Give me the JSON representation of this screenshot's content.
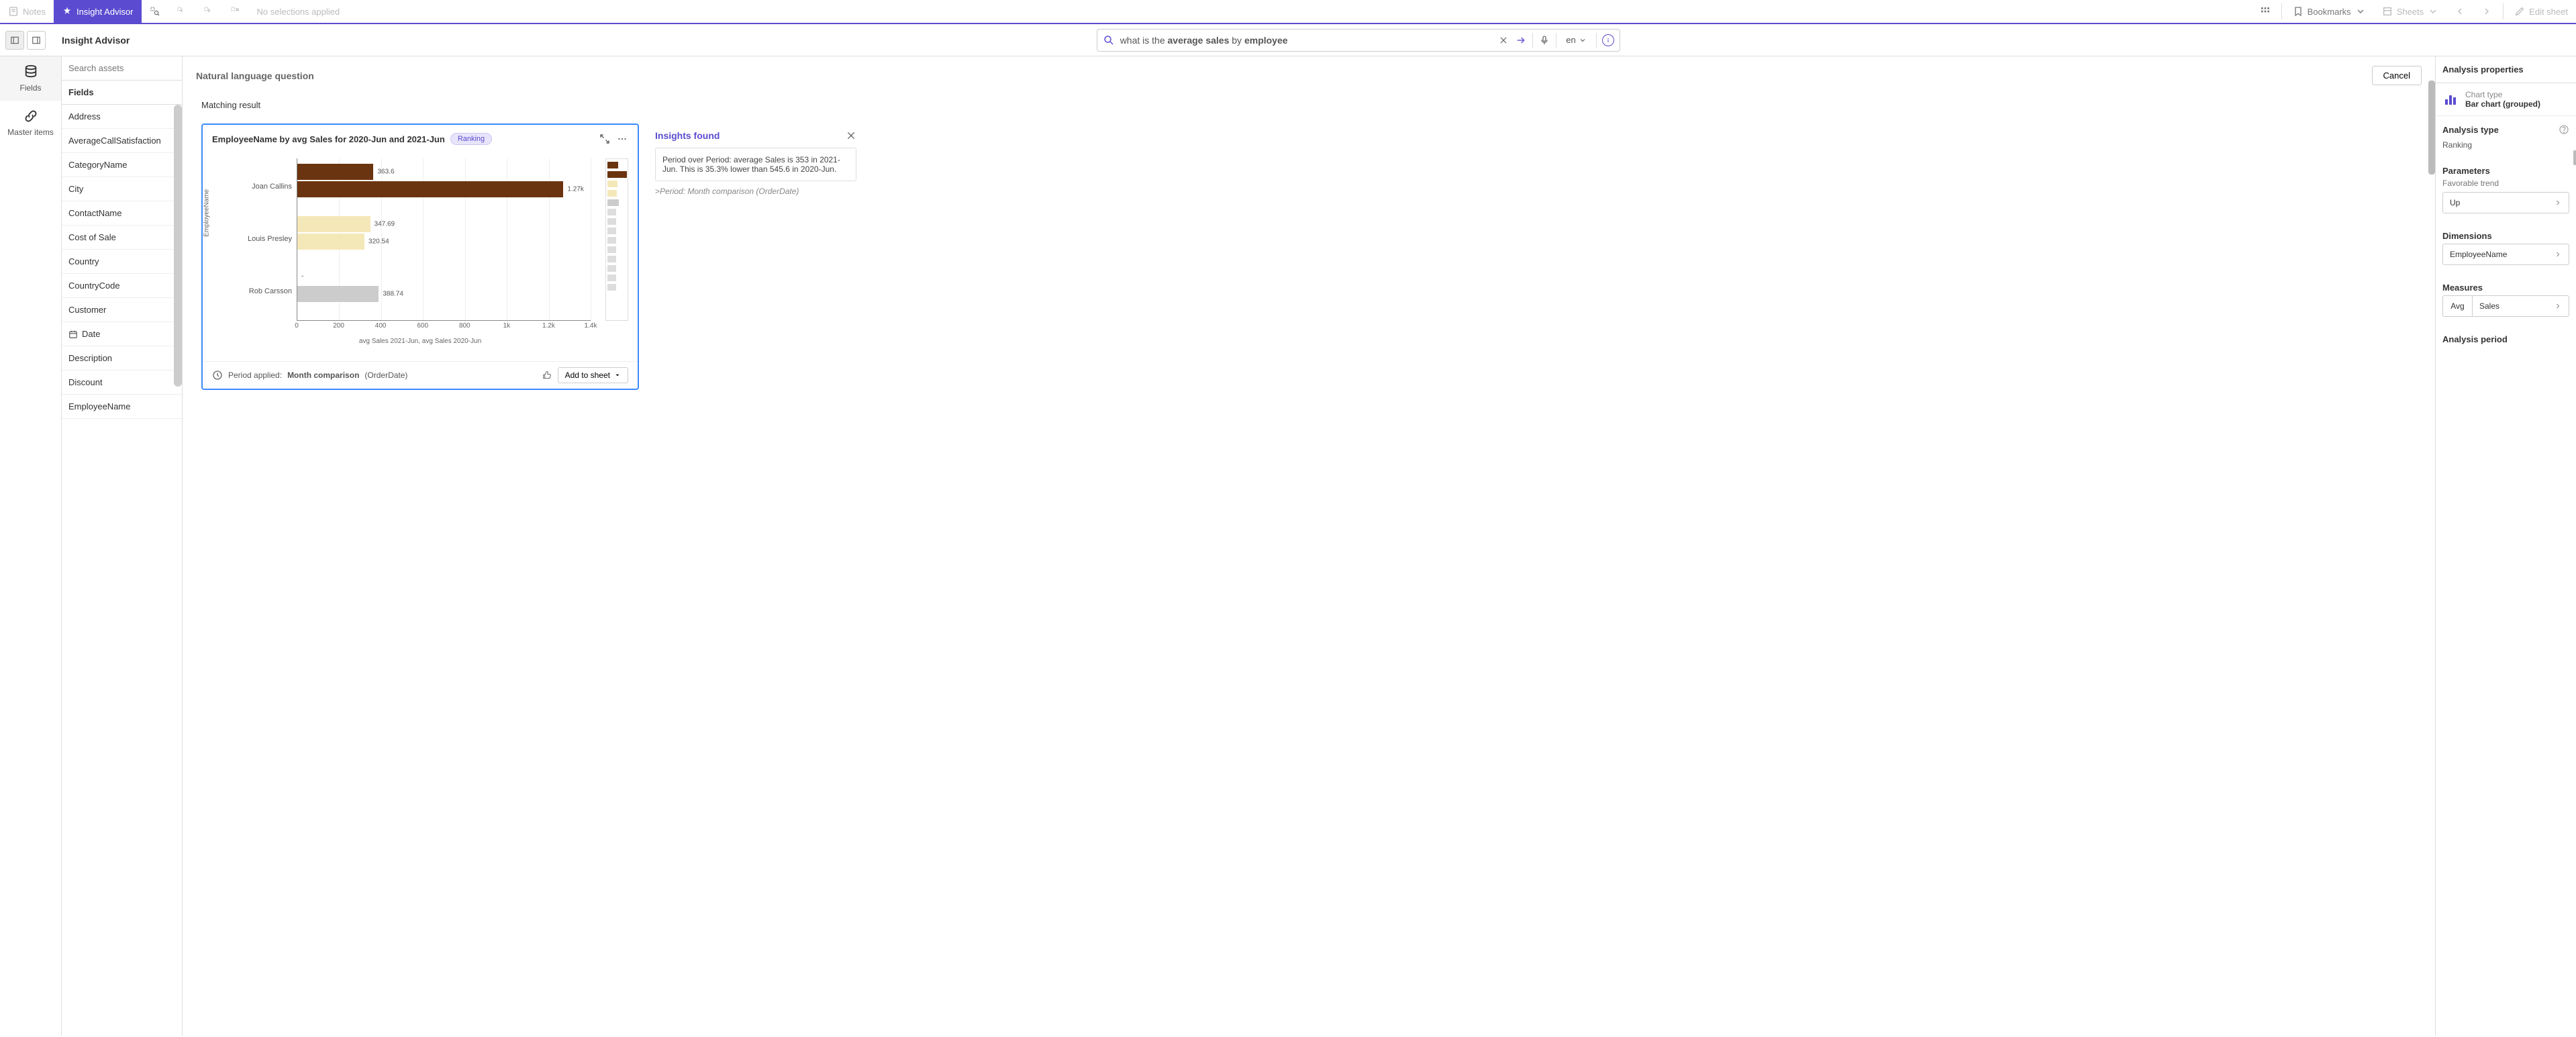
{
  "topbar": {
    "notes": "Notes",
    "insight_advisor": "Insight Advisor",
    "no_selections": "No selections applied",
    "bookmarks": "Bookmarks",
    "sheets": "Sheets",
    "edit_sheet": "Edit sheet"
  },
  "subbar": {
    "title": "Insight Advisor",
    "query_prefix": "what is the ",
    "query_bold1": "average sales",
    "query_mid": " by ",
    "query_bold2": "employee",
    "lang": "en"
  },
  "leftnav": {
    "fields": "Fields",
    "master": "Master items"
  },
  "fields_panel": {
    "search_placeholder": "Search assets",
    "heading": "Fields",
    "items": [
      "Address",
      "AverageCallSatisfaction",
      "CategoryName",
      "City",
      "ContactName",
      "Cost of Sale",
      "Country",
      "CountryCode",
      "Customer",
      "Date",
      "Description",
      "Discount",
      "EmployeeName"
    ],
    "date_index": 9
  },
  "center": {
    "nlq_title": "Natural language question",
    "cancel": "Cancel",
    "matching": "Matching result",
    "card": {
      "title": "EmployeeName by avg Sales for 2020-Jun and 2021-Jun",
      "badge": "Ranking",
      "period_label": "Period applied:",
      "period_bold": "Month comparison",
      "period_paren": "(OrderDate)",
      "add_to_sheet": "Add to sheet"
    },
    "insights": {
      "title": "Insights found",
      "body": "Period over Period: average Sales is 353 in 2021-Jun. This is 35.3% lower than 545.6 in 2020-Jun.",
      "note_prefix": ">",
      "note": "Period: Month comparison (OrderDate)"
    }
  },
  "chart_data": {
    "type": "bar",
    "orientation": "horizontal",
    "grouped": true,
    "ylabel": "EmployeeName",
    "xlabel": "avg Sales 2021-Jun, avg Sales 2020-Jun",
    "xlim": [
      0,
      1400
    ],
    "xticks": [
      0,
      200,
      400,
      600,
      800,
      "1k",
      "1.2k",
      "1.4k"
    ],
    "categories": [
      "Joan Callins",
      "Louis Presley",
      "Rob Carsson"
    ],
    "series": [
      {
        "name": "avg Sales 2021-Jun",
        "values": [
          363.6,
          347.69,
          null
        ],
        "labels": [
          "363.6",
          "347.69",
          "-"
        ],
        "color": "#6b3410"
      },
      {
        "name": "avg Sales 2020-Jun",
        "values": [
          1270,
          320.54,
          388.74
        ],
        "labels": [
          "1.27k",
          "320.54",
          "388.74"
        ],
        "color_by_category": [
          "#6b3410",
          "#f4e8b8",
          "#cccccc"
        ]
      }
    ]
  },
  "right": {
    "head": "Analysis properties",
    "chart_type_label": "Chart type",
    "chart_type_val": "Bar chart (grouped)",
    "analysis_type": "Analysis type",
    "analysis_type_val": "Ranking",
    "parameters": "Parameters",
    "fav_trend": "Favorable trend",
    "fav_val": "Up",
    "dimensions": "Dimensions",
    "dim_val": "EmployeeName",
    "measures": "Measures",
    "meas_agg": "Avg",
    "meas_val": "Sales",
    "analysis_period": "Analysis period"
  }
}
